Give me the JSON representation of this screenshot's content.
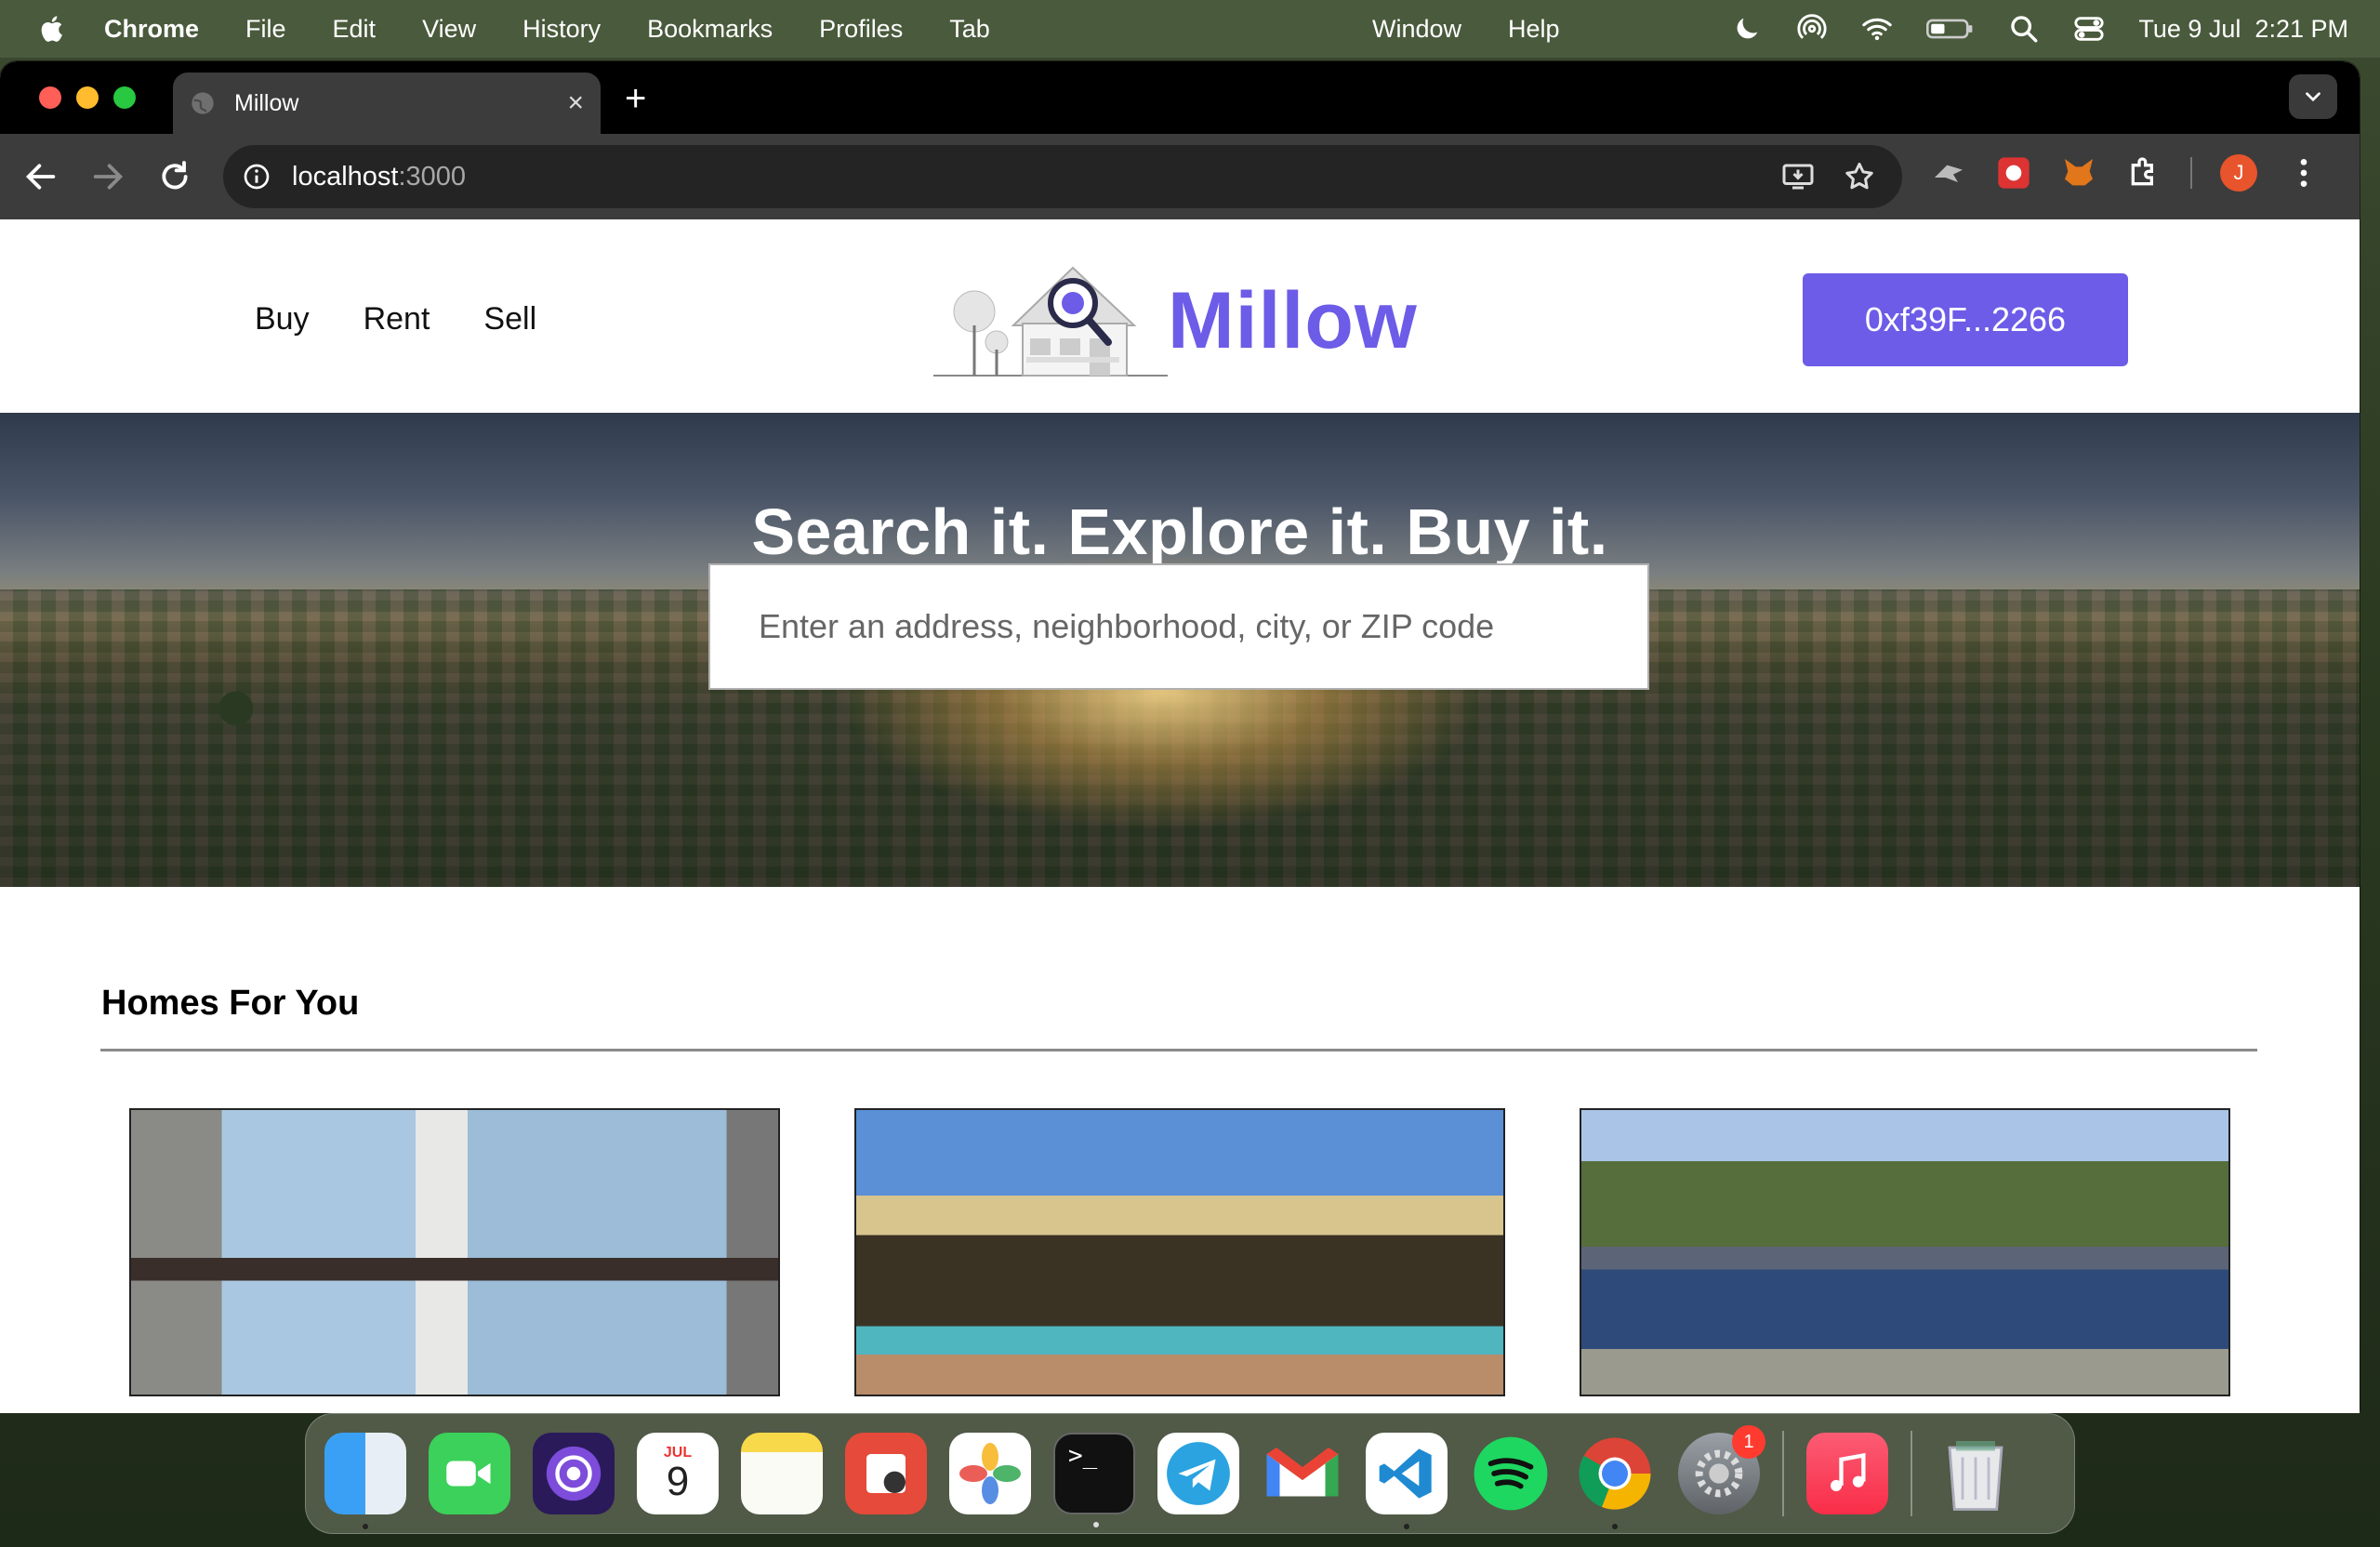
{
  "menubar": {
    "app_name": "Chrome",
    "items": [
      "File",
      "Edit",
      "View",
      "History",
      "Bookmarks",
      "Profiles",
      "Tab"
    ],
    "center_items": [
      "Window",
      "Help"
    ],
    "datetime": "Tue 9 Jul  2:21 PM"
  },
  "browser": {
    "tab_title": "Millow",
    "url_host": "localhost",
    "url_port": ":3000",
    "profile_initial": "J"
  },
  "site": {
    "nav": [
      "Buy",
      "Rent",
      "Sell"
    ],
    "brand": "Millow",
    "wallet_button": "0xf39F...2266",
    "hero_title": "Search it. Explore it. Buy it.",
    "search_placeholder": "Enter an address, neighborhood, city, or ZIP code",
    "section_title": "Homes For You"
  },
  "dock": {
    "calendar_month": "JUL",
    "calendar_day": "9",
    "settings_badge": "1"
  },
  "colors": {
    "accent": "#6c5ce7",
    "chrome_dark": "#3c3c3c"
  }
}
